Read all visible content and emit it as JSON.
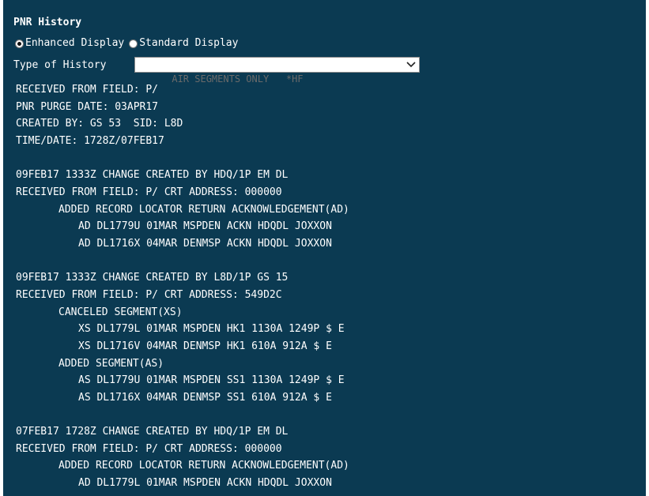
{
  "title": "PNR History",
  "display_options": [
    {
      "label": "Enhanced Display",
      "checked": true
    },
    {
      "label": "Standard Display",
      "checked": false
    }
  ],
  "history_type": {
    "label": "Type of History",
    "selected": "AIR SEGMENTS ONLY   *HF"
  },
  "lines": [
    {
      "text": "RECEIVED FROM FIELD: P/",
      "indent": 0
    },
    {
      "text": "PNR PURGE DATE: 03APR17",
      "indent": 0
    },
    {
      "text": "CREATED BY: GS 53  SID: L8D",
      "indent": 0
    },
    {
      "text": "TIME/DATE: 1728Z/07FEB17",
      "indent": 0
    },
    {
      "text": "",
      "indent": 0
    },
    {
      "text": "09FEB17 1333Z CHANGE CREATED BY HDQ/1P EM DL",
      "indent": 0
    },
    {
      "text": "RECEIVED FROM FIELD: P/ CRT ADDRESS: 000000",
      "indent": 0
    },
    {
      "text": "ADDED RECORD LOCATOR RETURN ACKNOWLEDGEMENT(AD)",
      "indent": 1
    },
    {
      "text": "AD DL1779U 01MAR MSPDEN ACKN HDQDL JOXXON",
      "indent": 2
    },
    {
      "text": "AD DL1716X 04MAR DENMSP ACKN HDQDL JOXXON",
      "indent": 2
    },
    {
      "text": "",
      "indent": 0
    },
    {
      "text": "09FEB17 1333Z CHANGE CREATED BY L8D/1P GS 15",
      "indent": 0
    },
    {
      "text": "RECEIVED FROM FIELD: P/ CRT ADDRESS: 549D2C",
      "indent": 0
    },
    {
      "text": "CANCELED SEGMENT(XS)",
      "indent": 1
    },
    {
      "text": "XS DL1779L 01MAR MSPDEN HK1 1130A 1249P $ E",
      "indent": 2
    },
    {
      "text": "XS DL1716V 04MAR DENMSP HK1 610A 912A $ E",
      "indent": 2
    },
    {
      "text": "ADDED SEGMENT(AS)",
      "indent": 1
    },
    {
      "text": "AS DL1779U 01MAR MSPDEN SS1 1130A 1249P $ E",
      "indent": 2
    },
    {
      "text": "AS DL1716X 04MAR DENMSP SS1 610A 912A $ E",
      "indent": 2
    },
    {
      "text": "",
      "indent": 0
    },
    {
      "text": "07FEB17 1728Z CHANGE CREATED BY HDQ/1P EM DL",
      "indent": 0
    },
    {
      "text": "RECEIVED FROM FIELD: P/ CRT ADDRESS: 000000",
      "indent": 0
    },
    {
      "text": "ADDED RECORD LOCATOR RETURN ACKNOWLEDGEMENT(AD)",
      "indent": 1
    },
    {
      "text": "AD DL1779L 01MAR MSPDEN ACKN HDQDL JOXXON",
      "indent": 2
    }
  ],
  "colors": {
    "background": "#0b3a52",
    "text": "#ffffff"
  }
}
